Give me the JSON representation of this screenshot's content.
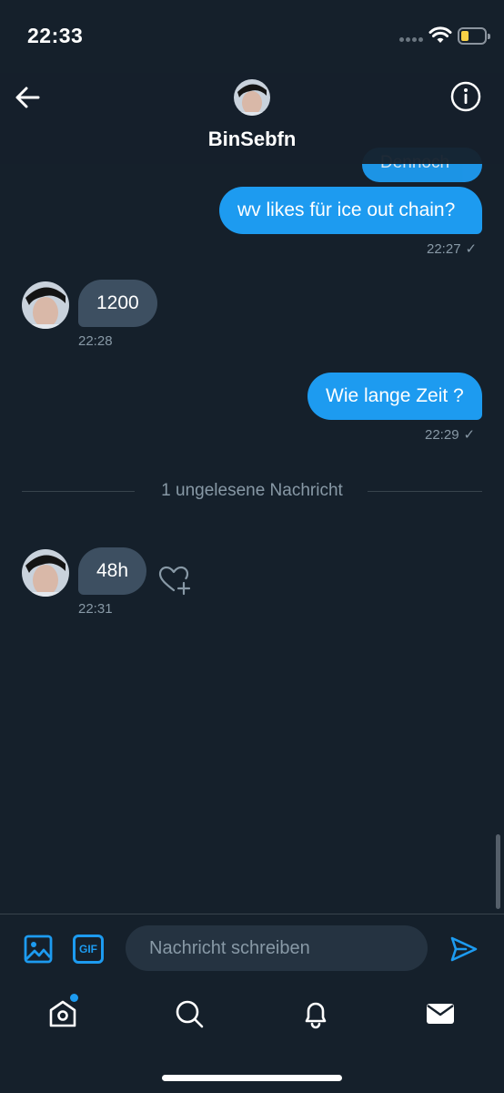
{
  "status_bar": {
    "time": "22:33"
  },
  "header": {
    "contact_name": "BinSebfn"
  },
  "messages": {
    "hidden_prev": {
      "text": "Dennoch"
    },
    "m1": {
      "text": "wv likes für ice out chain?",
      "time": "22:27",
      "check": "✓"
    },
    "m2": {
      "text": "1200",
      "time": "22:28"
    },
    "m3": {
      "text": "Wie lange Zeit ?",
      "time": "22:29",
      "check": "✓"
    },
    "m4": {
      "text": "48h",
      "time": "22:31"
    }
  },
  "divider": {
    "label": "1 ungelesene Nachricht"
  },
  "composer": {
    "placeholder": "Nachricht schreiben",
    "gif_label": "GIF"
  },
  "colors": {
    "background": "#15202b",
    "accent": "#1d9bf0",
    "incoming_bubble": "#3d4f61",
    "muted_text": "#8899a6"
  },
  "icons": [
    "back-arrow-icon",
    "info-icon",
    "image-icon",
    "gif-icon",
    "send-icon",
    "home-icon",
    "search-icon",
    "bell-icon",
    "mail-icon",
    "heart-plus-icon"
  ]
}
